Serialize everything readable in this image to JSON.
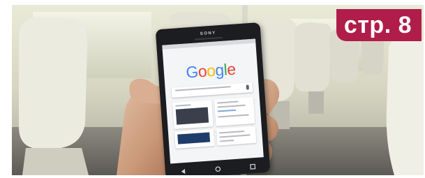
{
  "page_label": "стр. 8",
  "phone": {
    "brand": "SONY",
    "screen_logo": "Google"
  },
  "colors": {
    "label_bg": "#b01d4a",
    "label_text": "#ffffff",
    "google_blue": "#4285f4",
    "google_red": "#ea4335",
    "google_yellow": "#fbbc05",
    "google_green": "#34a853"
  }
}
